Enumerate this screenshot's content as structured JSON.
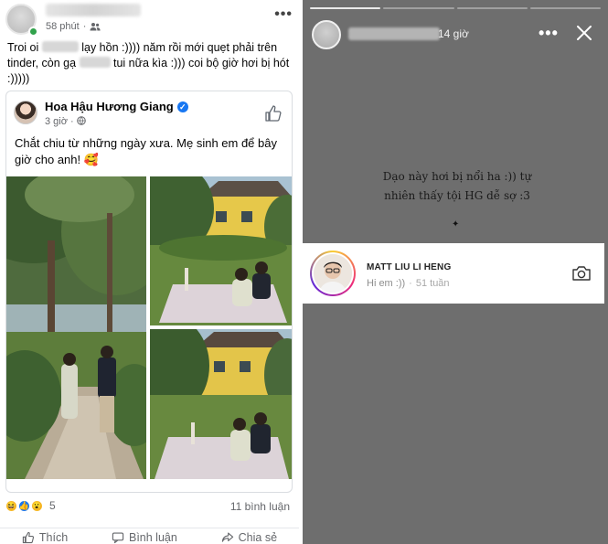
{
  "facebook_post": {
    "time": "58 phút",
    "text_parts": [
      "Troi oi ",
      " lạy hồn :)))) năm rồi mới quẹt phải trên tinder, còn gạ ",
      " tui nữa kìa :))) coi bộ giờ hơi bị hót :)))))"
    ],
    "shared": {
      "page_name": "Hoa Hậu Hương Giang",
      "time": "3 giờ",
      "text": "Chắt chiu từ những ngày xưa. Mẹ sinh em để bây giờ cho anh! 🥰"
    },
    "reaction_count": "5",
    "comment_count": "11 bình luận",
    "actions": {
      "like": "Thích",
      "comment": "Bình luận",
      "share": "Chia sẻ"
    }
  },
  "story": {
    "time": "14 giờ",
    "caption": "Dạo này hơi bị nổi ha :)) tự nhiên thấy tội HG dễ sợ :3",
    "sparkle": "✦",
    "message_card": {
      "username": "MATT LIU LI HENG",
      "message": "Hi em :))",
      "age": "51 tuần"
    }
  }
}
